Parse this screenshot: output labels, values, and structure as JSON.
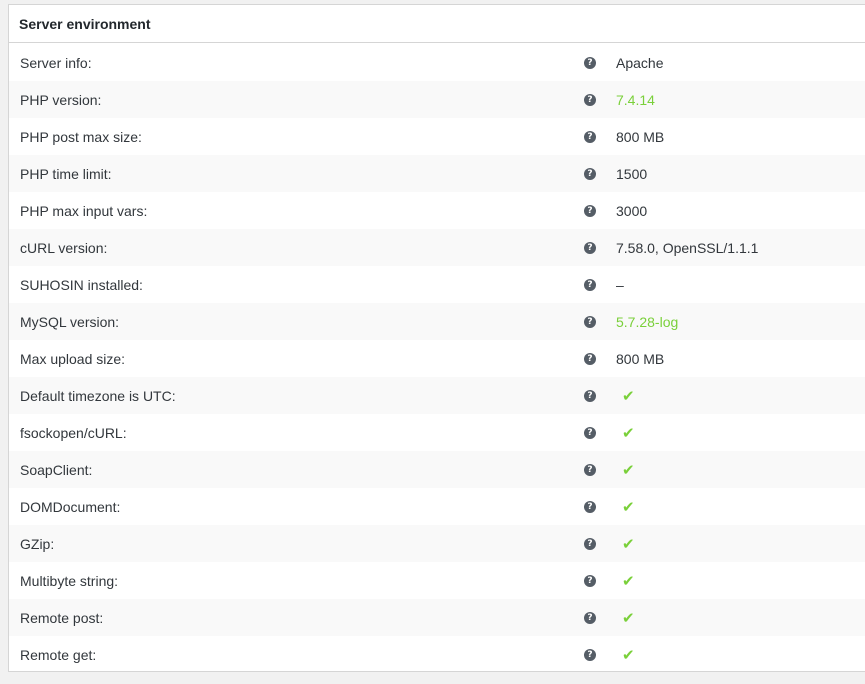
{
  "section": {
    "title": "Server environment"
  },
  "colors": {
    "ok": "#7ad03a",
    "help": "#555d66"
  },
  "rows": [
    {
      "label": "Server info:",
      "value": "Apache",
      "status": "text"
    },
    {
      "label": "PHP version:",
      "value": "7.4.14",
      "status": "ok"
    },
    {
      "label": "PHP post max size:",
      "value": "800 MB",
      "status": "text"
    },
    {
      "label": "PHP time limit:",
      "value": "1500",
      "status": "text"
    },
    {
      "label": "PHP max input vars:",
      "value": "3000",
      "status": "text"
    },
    {
      "label": "cURL version:",
      "value": "7.58.0, OpenSSL/1.1.1",
      "status": "text"
    },
    {
      "label": "SUHOSIN installed:",
      "value": "–",
      "status": "text"
    },
    {
      "label": "MySQL version:",
      "value": "5.7.28-log",
      "status": "ok"
    },
    {
      "label": "Max upload size:",
      "value": "800 MB",
      "status": "text"
    },
    {
      "label": "Default timezone is UTC:",
      "value": "✔",
      "status": "check"
    },
    {
      "label": "fsockopen/cURL:",
      "value": "✔",
      "status": "check"
    },
    {
      "label": "SoapClient:",
      "value": "✔",
      "status": "check"
    },
    {
      "label": "DOMDocument:",
      "value": "✔",
      "status": "check"
    },
    {
      "label": "GZip:",
      "value": "✔",
      "status": "check"
    },
    {
      "label": "Multibyte string:",
      "value": "✔",
      "status": "check"
    },
    {
      "label": "Remote post:",
      "value": "✔",
      "status": "check"
    },
    {
      "label": "Remote get:",
      "value": "✔",
      "status": "check"
    }
  ]
}
